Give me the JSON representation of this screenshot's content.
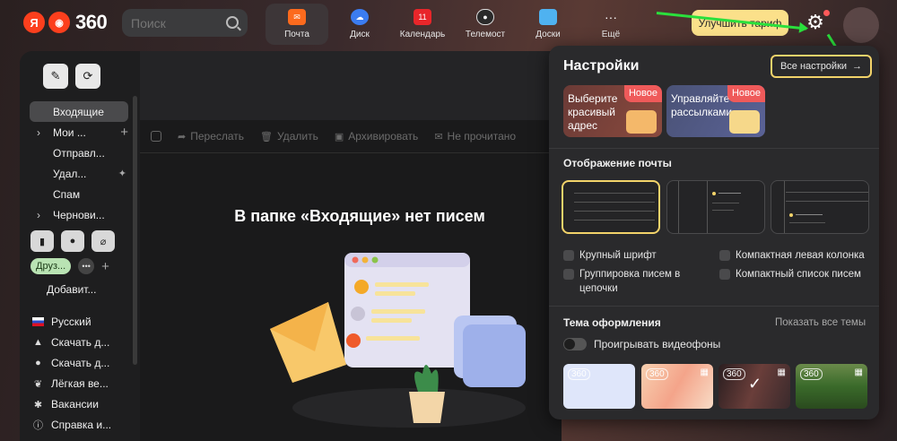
{
  "logo": {
    "ya": "Я",
    "brand": "360"
  },
  "search": {
    "placeholder": "Поиск"
  },
  "services": [
    {
      "label": "Почта",
      "color": "#fc6a1d"
    },
    {
      "label": "Диск",
      "color": "#3b7cf0"
    },
    {
      "label": "Календарь",
      "color": "#e8262a",
      "badge": "11"
    },
    {
      "label": "Телемост",
      "color": "#222222"
    },
    {
      "label": "Доски",
      "color": "#4fb2f0"
    },
    {
      "label": "Ещё",
      "color": "#555555"
    }
  ],
  "upgrade_label": "Улучшить тариф",
  "sidebar": {
    "folders": [
      "Входящие",
      "Мои ...",
      "Отправл...",
      "Удал...",
      "Спам",
      "Чернови..."
    ],
    "tag": "Друз...",
    "add_label": "Добавит...",
    "links": [
      "Русский",
      "Скачать д...",
      "Скачать д...",
      "Лёгкая ве...",
      "Вакансии",
      "Справка и..."
    ]
  },
  "toolbar": {
    "forward": "Переслать",
    "delete": "Удалить",
    "archive": "Архивировать",
    "unread": "Не прочитано"
  },
  "empty_message": "В папке «Входящие» нет писем",
  "settings": {
    "title": "Настройки",
    "all_settings": "Все настройки",
    "promo1": {
      "text": "Выберите красивый адрес",
      "badge": "Новое"
    },
    "promo2": {
      "text": "Управляйте рассылками",
      "badge": "Новое"
    },
    "display_title": "Отображение почты",
    "options": [
      "Крупный шрифт",
      "Группировка писем в цепочки",
      "Компактная левая колонка",
      "Компактный список писем"
    ],
    "theme_title": "Тема оформления",
    "show_all_themes": "Показать все темы",
    "video_toggle": "Проигрывать видеофоны",
    "theme_badge": "360",
    "checkmark": "✓"
  },
  "colors": {
    "accent": "#f2d36a",
    "new_badge": "#ef5a5a",
    "pointer": "#2ae03c"
  }
}
